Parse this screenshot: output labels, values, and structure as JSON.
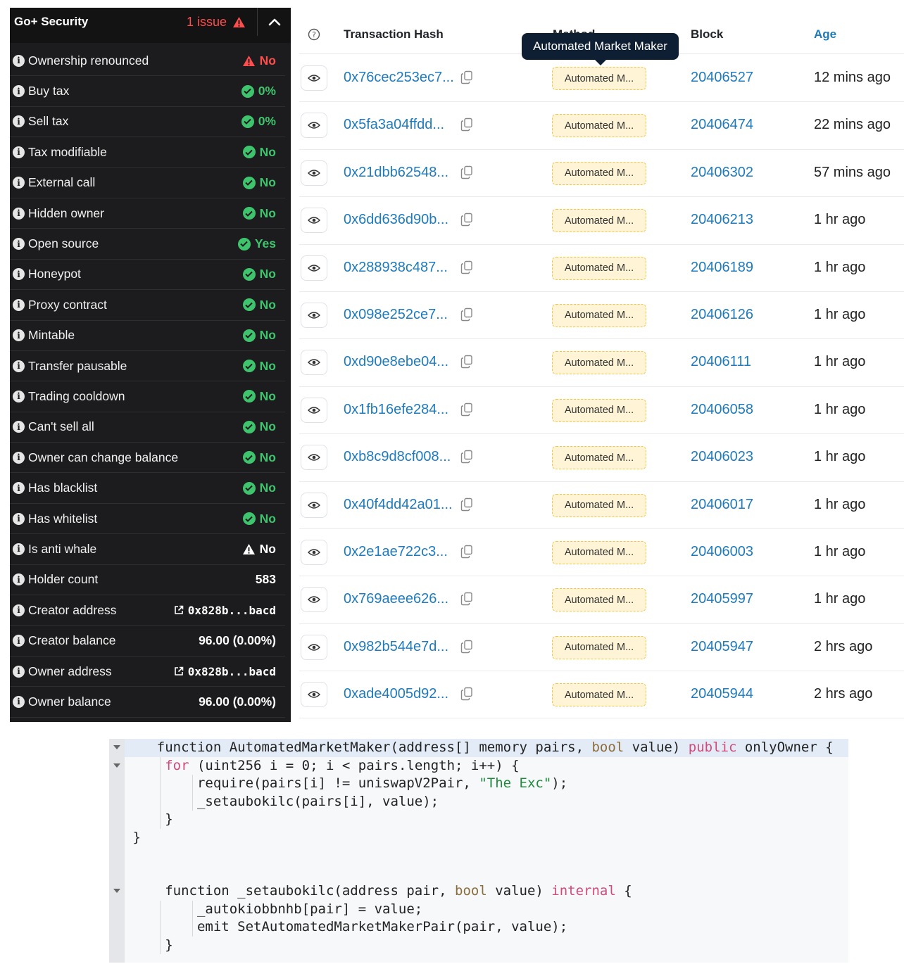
{
  "security": {
    "title": "Go+ Security",
    "issue_text": "1 issue",
    "rows": [
      {
        "label": "Ownership renounced",
        "value": "No",
        "status": "warn-red"
      },
      {
        "label": "Buy tax",
        "value": "0%",
        "status": "ok"
      },
      {
        "label": "Sell tax",
        "value": "0%",
        "status": "ok"
      },
      {
        "label": "Tax modifiable",
        "value": "No",
        "status": "ok"
      },
      {
        "label": "External call",
        "value": "No",
        "status": "ok"
      },
      {
        "label": "Hidden owner",
        "value": "No",
        "status": "ok"
      },
      {
        "label": "Open source",
        "value": "Yes",
        "status": "ok"
      },
      {
        "label": "Honeypot",
        "value": "No",
        "status": "ok"
      },
      {
        "label": "Proxy contract",
        "value": "No",
        "status": "ok"
      },
      {
        "label": "Mintable",
        "value": "No",
        "status": "ok"
      },
      {
        "label": "Transfer pausable",
        "value": "No",
        "status": "ok"
      },
      {
        "label": "Trading cooldown",
        "value": "No",
        "status": "ok"
      },
      {
        "label": "Can't sell all",
        "value": "No",
        "status": "ok"
      },
      {
        "label": "Owner can change balance",
        "value": "No",
        "status": "ok"
      },
      {
        "label": "Has blacklist",
        "value": "No",
        "status": "ok"
      },
      {
        "label": "Has whitelist",
        "value": "No",
        "status": "ok"
      },
      {
        "label": "Is anti whale",
        "value": "No",
        "status": "warn-white"
      },
      {
        "label": "Holder count",
        "value": "583",
        "status": "plain"
      },
      {
        "label": "Creator address",
        "value": "0x828b...bacd",
        "status": "link"
      },
      {
        "label": "Creator balance",
        "value": "96.00 (0.00%)",
        "status": "plain"
      },
      {
        "label": "Owner address",
        "value": "0x828b...bacd",
        "status": "link"
      },
      {
        "label": "Owner balance",
        "value": "96.00 (0.00%)",
        "status": "plain"
      }
    ]
  },
  "transactions": {
    "headers": {
      "hash": "Transaction Hash",
      "method": "Method",
      "block": "Block",
      "age": "Age"
    },
    "tooltip": "Automated Market Maker",
    "rows": [
      {
        "hash": "0x76cec253ec7...",
        "method": "Automated M...",
        "block": "20406527",
        "age": "12 mins ago"
      },
      {
        "hash": "0x5fa3a04ffdd...",
        "method": "Automated M...",
        "block": "20406474",
        "age": "22 mins ago"
      },
      {
        "hash": "0x21dbb62548...",
        "method": "Automated M...",
        "block": "20406302",
        "age": "57 mins ago"
      },
      {
        "hash": "0x6dd636d90b...",
        "method": "Automated M...",
        "block": "20406213",
        "age": "1 hr ago"
      },
      {
        "hash": "0x288938c487...",
        "method": "Automated M...",
        "block": "20406189",
        "age": "1 hr ago"
      },
      {
        "hash": "0x098e252ce7...",
        "method": "Automated M...",
        "block": "20406126",
        "age": "1 hr ago"
      },
      {
        "hash": "0xd90e8ebe04...",
        "method": "Automated M...",
        "block": "20406111",
        "age": "1 hr ago"
      },
      {
        "hash": "0x1fb16efe284...",
        "method": "Automated M...",
        "block": "20406058",
        "age": "1 hr ago"
      },
      {
        "hash": "0xb8c9d8cf008...",
        "method": "Automated M...",
        "block": "20406023",
        "age": "1 hr ago"
      },
      {
        "hash": "0x40f4dd42a01...",
        "method": "Automated M...",
        "block": "20406017",
        "age": "1 hr ago"
      },
      {
        "hash": "0x2e1ae722c3...",
        "method": "Automated M...",
        "block": "20406003",
        "age": "1 hr ago"
      },
      {
        "hash": "0x769aeee626...",
        "method": "Automated M...",
        "block": "20405997",
        "age": "1 hr ago"
      },
      {
        "hash": "0x982b544e7d...",
        "method": "Automated M...",
        "block": "20405947",
        "age": "2 hrs ago"
      },
      {
        "hash": "0xade4005d92...",
        "method": "Automated M...",
        "block": "20405944",
        "age": "2 hrs ago"
      }
    ]
  },
  "code": {
    "lines": [
      "    function AutomatedMarketMaker(address[] memory pairs, bool value) public onlyOwner {",
      "     for (uint256 i = 0; i < pairs.length; i++) {",
      "         require(pairs[i] != uniswapV2Pair, \"The Exc\");",
      "         _setaubokilc(pairs[i], value);",
      "     }",
      " }",
      "",
      "",
      "     function _setaubokilc(address pair, bool value) internal {",
      "         _autokiobbnhb[pair] = value;",
      "         emit SetAutomatedMarketMakerPair(pair, value);",
      "     }"
    ]
  },
  "colors": {
    "accent_blue": "#1e7bbd",
    "ok_green": "#3ec46d",
    "warn_red": "#ff4d4d",
    "badge_bg": "#fff5d6"
  }
}
